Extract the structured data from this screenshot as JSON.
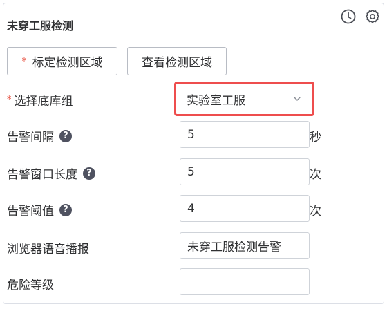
{
  "panel": {
    "title": "未穿工服检测"
  },
  "toolbar": {
    "mark_area_required": "*",
    "mark_area_label": "标定检测区域",
    "view_area_label": "查看检测区域"
  },
  "form": {
    "base_group": {
      "required": "*",
      "label": "选择底库组",
      "value": "实验室工服"
    },
    "alarm_interval": {
      "label": "告警间隔",
      "help": "?",
      "value": "5",
      "unit": "秒"
    },
    "alarm_window": {
      "label": "告警窗口长度",
      "help": "?",
      "value": "5",
      "unit": "次"
    },
    "alarm_threshold": {
      "label": "告警阈值",
      "help": "?",
      "value": "4",
      "unit": "次"
    },
    "browser_voice": {
      "label": "浏览器语音播报",
      "value": "未穿工服检测告警"
    },
    "danger_level": {
      "label": "危险等级",
      "value": ""
    }
  },
  "colors": {
    "highlight_border": "#ee4d4d",
    "required_star": "#e74c3c"
  },
  "icons": [
    "clock-icon",
    "gear-icon",
    "help-icon",
    "chevron-down-icon"
  ]
}
